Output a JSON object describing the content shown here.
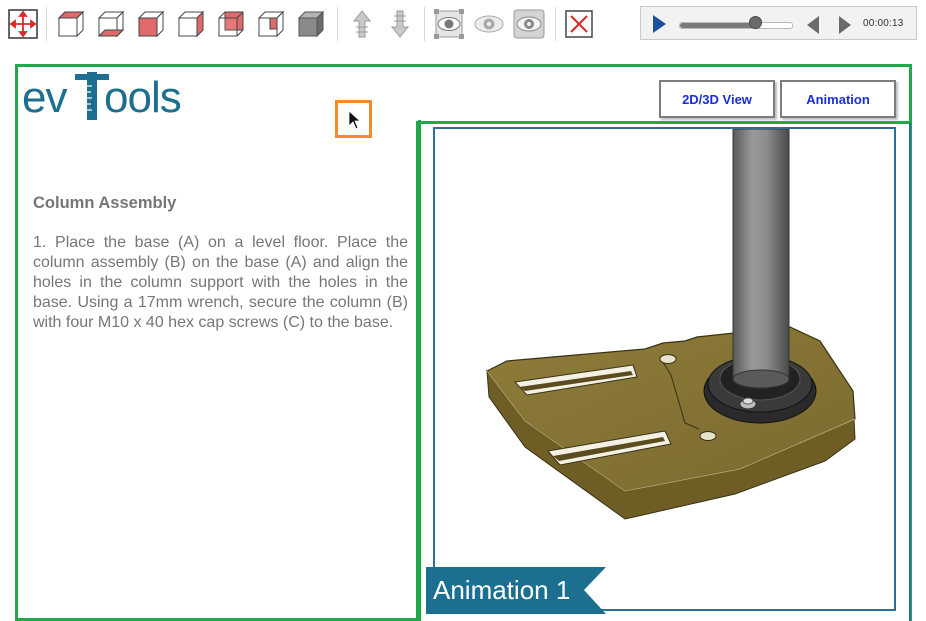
{
  "toolbar": {
    "buttons": [
      {
        "name": "fit-view-icon"
      },
      {
        "name": "view-front-icon"
      },
      {
        "name": "view-top-icon"
      },
      {
        "name": "view-left-icon"
      },
      {
        "name": "view-right-icon"
      },
      {
        "name": "view-back-icon"
      },
      {
        "name": "view-iso-icon"
      },
      {
        "name": "view-solid-icon"
      },
      {
        "name": "explode-up-icon"
      },
      {
        "name": "explode-down-icon"
      },
      {
        "name": "select-view-icon"
      },
      {
        "name": "show-icon"
      },
      {
        "name": "hide-icon"
      },
      {
        "name": "close-icon"
      }
    ]
  },
  "player": {
    "time": "00:00:13",
    "progress": 0.68
  },
  "logo": {
    "text_left": "ev",
    "text_right": "ools"
  },
  "buttons": {
    "view_toggle": "2D/3D View",
    "animation": "Animation"
  },
  "instructions": {
    "heading": "Column Assembly",
    "body": "1. Place the base (A) on a level floor. Place the column assembly (B) on the base (A) and align the holes in the column support with the holes in the base. Using a 17mm wrench, secure the column (B) with four  M10 x 40 hex cap screws (C) to the base."
  },
  "animation_label": "Animation 1",
  "colors": {
    "accent_green": "#22a84a",
    "frame_blue": "#2a7193",
    "label_blue": "#1d6f8f",
    "button_text": "#1a2ed8",
    "cursor_highlight": "#f28a2e",
    "base_color": "#8b7a3b"
  }
}
